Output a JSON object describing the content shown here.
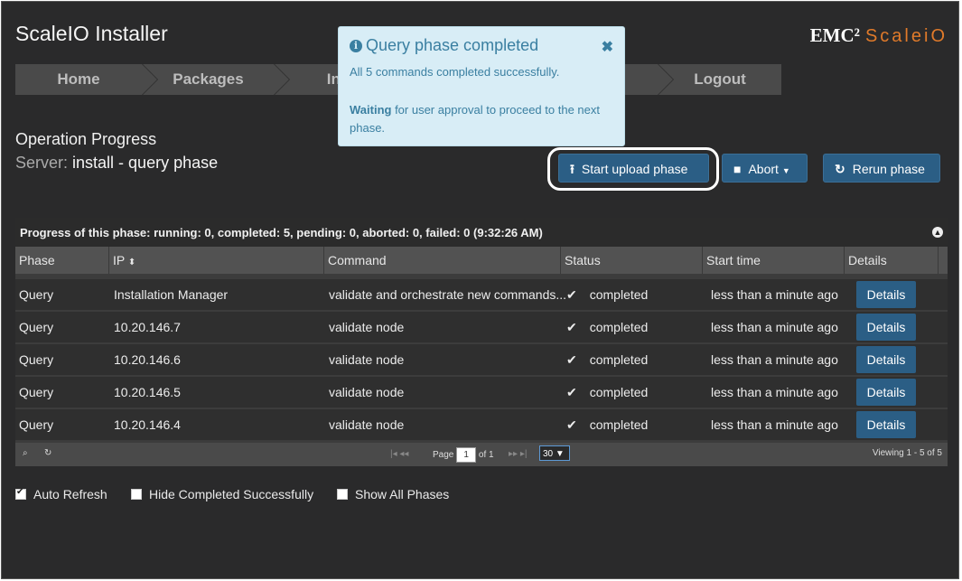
{
  "app": {
    "title": "ScaleIO Installer",
    "brand_emc": "EMC²",
    "brand_product": "ScaleiO"
  },
  "nav": {
    "items": [
      "Home",
      "Packages",
      "Ins",
      "",
      "Logout"
    ]
  },
  "popup": {
    "title": "Query phase completed",
    "message": "All 5 commands completed successfully.",
    "waiting_bold": "Waiting",
    "waiting_rest": " for user approval to proceed to the next phase."
  },
  "operation": {
    "title": "Operation Progress",
    "server_label": "Server:",
    "server_value": " install - query phase"
  },
  "actions": {
    "start_upload": "Start upload phase",
    "abort": "Abort",
    "rerun": "Rerun phase"
  },
  "grid": {
    "caption": "Progress of this phase: running: 0, completed: 5, pending: 0, aborted: 0, failed: 0 (9:32:26 AM)",
    "columns": [
      "Phase",
      "IP",
      "Command",
      "Status",
      "Start time",
      "Details"
    ],
    "rows": [
      {
        "phase": "Query",
        "ip": "Installation Manager",
        "command": "validate and orchestrate new commands...",
        "status": "completed",
        "start": "less than a minute ago",
        "details": "Details"
      },
      {
        "phase": "Query",
        "ip": "10.20.146.7",
        "command": "validate node",
        "status": "completed",
        "start": "less than a minute ago",
        "details": "Details"
      },
      {
        "phase": "Query",
        "ip": "10.20.146.6",
        "command": "validate node",
        "status": "completed",
        "start": "less than a minute ago",
        "details": "Details"
      },
      {
        "phase": "Query",
        "ip": "10.20.146.5",
        "command": "validate node",
        "status": "completed",
        "start": "less than a minute ago",
        "details": "Details"
      },
      {
        "phase": "Query",
        "ip": "10.20.146.4",
        "command": "validate node",
        "status": "completed",
        "start": "less than a minute ago",
        "details": "Details"
      }
    ],
    "pager": {
      "page_label": "Page",
      "page_value": "1",
      "of_label": "of 1",
      "page_size": "30",
      "viewing": "Viewing 1 - 5 of 5"
    }
  },
  "options": {
    "auto_refresh": "Auto Refresh",
    "hide_completed": "Hide Completed Successfully",
    "show_all": "Show All Phases"
  },
  "colors": {
    "background": "#2a2a2b",
    "primary_button": "#2b5e85",
    "popup_bg": "#d8edf6",
    "popup_text": "#3a7fa1",
    "brand_accent": "#e07a2a"
  }
}
